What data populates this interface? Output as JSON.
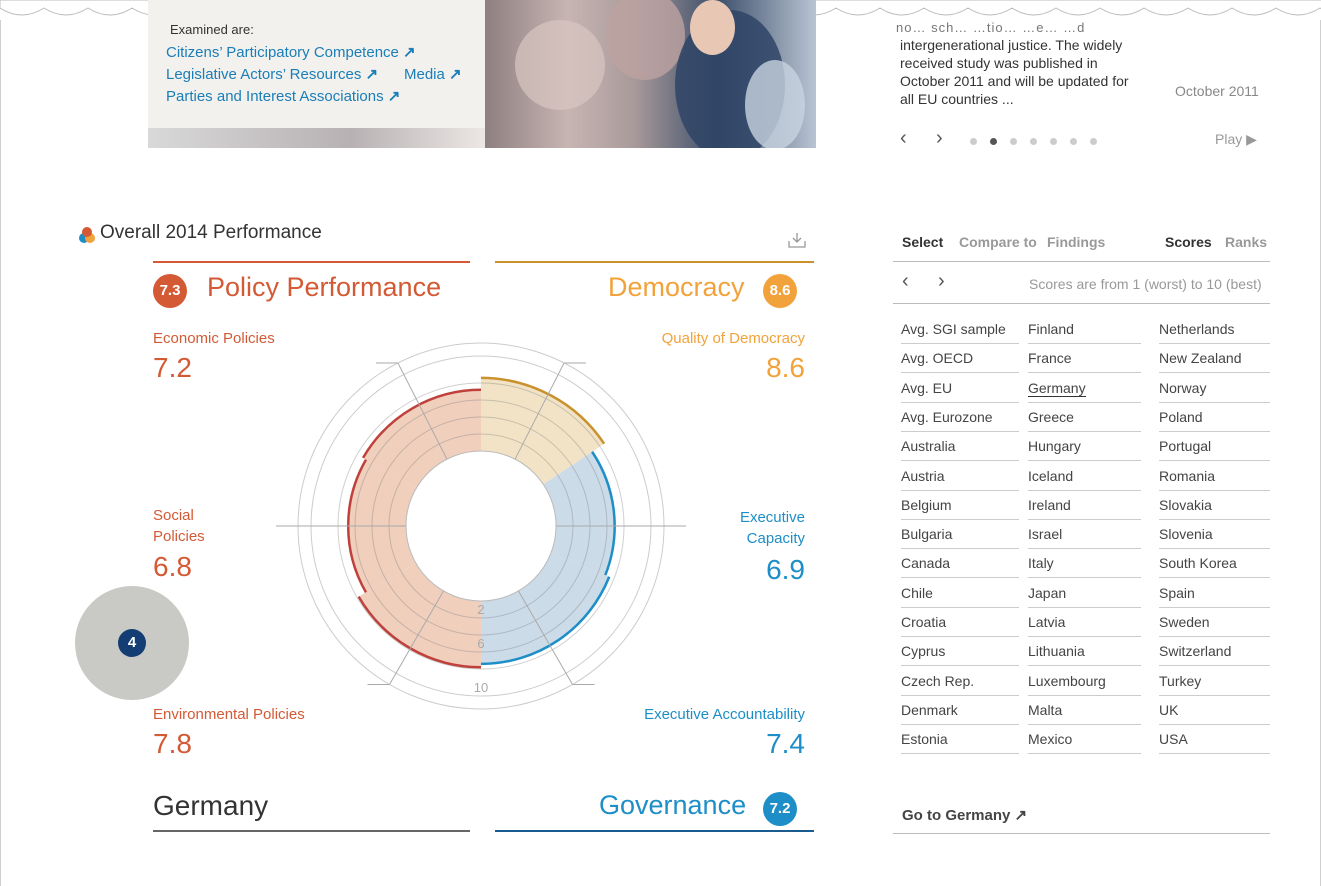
{
  "promo": {
    "examined_label": "Examined are:",
    "links": [
      {
        "label": "Citizens’ Participatory Competence",
        "arrow": "↗"
      },
      {
        "label": "Legislative Actors’ Resources",
        "arrow": "↗"
      },
      {
        "label": "Media",
        "arrow": "↗"
      },
      {
        "label": "Parties and Interest Associations",
        "arrow": "↗"
      }
    ]
  },
  "news": {
    "text_line0": "no… sch…  …tio… …e… …d",
    "text": "intergenerational justice. The widely received study was published in October 2011 and will be updated for all EU countries ...",
    "date": "October 2011",
    "prev": "‹",
    "next": "›",
    "dots_count": 7,
    "active_dot": 2,
    "play_label": "Play ▶"
  },
  "section": {
    "title": "Overall 2014 Performance",
    "download_icon": "download-icon"
  },
  "pillars": {
    "policy": {
      "title": "Policy Performance",
      "score": "7.3",
      "color": "#d35a35"
    },
    "democracy": {
      "title": "Democracy",
      "score": "8.6",
      "color": "#f2a23a"
    },
    "governance": {
      "title": "Governance",
      "score": "7.2",
      "color": "#1d8ec7"
    }
  },
  "categories": {
    "economic": {
      "label": "Economic Policies",
      "value": "7.2"
    },
    "social": {
      "label_line1": "Social",
      "label_line2": "Policies",
      "value": "6.8"
    },
    "environmental": {
      "label": "Environmental Policies",
      "value": "7.8"
    },
    "quality_democracy": {
      "label": "Quality of Democracy",
      "value": "8.6"
    },
    "executive_capacity": {
      "label_line1": "Executive",
      "label_line2": "Capacity",
      "value": "6.9"
    },
    "executive_accountability": {
      "label": "Executive Accountability",
      "value": "7.4"
    }
  },
  "chart_data": {
    "type": "radial-bar",
    "ring_labels": [
      "2",
      "6",
      "10"
    ],
    "scale": [
      0,
      10
    ],
    "segments": [
      {
        "name": "Quality of Democracy",
        "value": 8.6,
        "color": "#f2e3c6"
      },
      {
        "name": "Executive Capacity",
        "value": 6.9,
        "color": "#ccdbe8"
      },
      {
        "name": "Executive Accountability",
        "value": 7.4,
        "color": "#ccdbe8"
      },
      {
        "name": "Environmental Policies",
        "value": 7.8,
        "color": "#f0cfbd"
      },
      {
        "name": "Social Policies",
        "value": 6.8,
        "color": "#f0cfbd"
      },
      {
        "name": "Economic Policies",
        "value": 7.2,
        "color": "#f0cfbd"
      }
    ]
  },
  "country": {
    "name": "Germany",
    "rank": "4"
  },
  "panel": {
    "tabs_left": [
      "Select",
      "Compare to",
      "Findings"
    ],
    "tabs_right": [
      "Scores",
      "Ranks"
    ],
    "prev": "‹",
    "next": "›",
    "note": "Scores are from 1 (worst) to 10 (best)",
    "col1": [
      "Avg. SGI sample",
      "Avg. OECD",
      "Avg. EU",
      "Avg. Eurozone",
      "Australia",
      "Austria",
      "Belgium",
      "Bulgaria",
      "Canada",
      "Chile",
      "Croatia",
      "Cyprus",
      "Czech Rep.",
      "Denmark",
      "Estonia"
    ],
    "col2": [
      "Finland",
      "France",
      "Germany",
      "Greece",
      "Hungary",
      "Iceland",
      "Ireland",
      "Israel",
      "Italy",
      "Japan",
      "Latvia",
      "Lithuania",
      "Luxembourg",
      "Malta",
      "Mexico"
    ],
    "col3": [
      "Netherlands",
      "New Zealand",
      "Norway",
      "Poland",
      "Portugal",
      "Romania",
      "Slovakia",
      "Slovenia",
      "South Korea",
      "Spain",
      "Sweden",
      "Switzerland",
      "Turkey",
      "UK",
      "USA"
    ],
    "selected": "Germany",
    "goto": "Go to Germany ↗"
  }
}
